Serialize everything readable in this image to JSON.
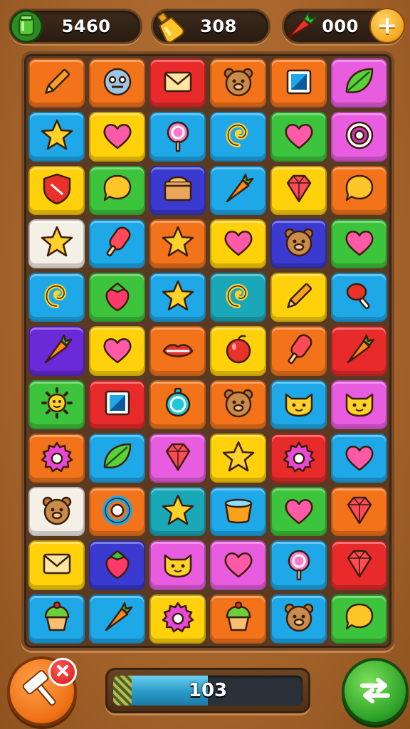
{
  "resources": {
    "coins": {
      "value": "5460",
      "icon": "green-jar-icon"
    },
    "potion": {
      "value": "308",
      "icon": "potion-bottle-icon"
    },
    "gems": {
      "value": "000",
      "icon": "carrot-icon",
      "add_icon": "plus-icon"
    }
  },
  "colors": {
    "orange": "#f2731a",
    "blue": "#1ea8e8",
    "yellow": "#ffd10a",
    "green": "#3cc43c",
    "pink": "#e85ce0",
    "navy": "#3a3ad0",
    "red": "#e82a2a",
    "teal": "#1aa8b8",
    "white": "#f4f0e6",
    "purple": "#6a2ad8",
    "magenta": "#d83ab8",
    "lightorange": "#ff8a2a"
  },
  "board": {
    "rows": [
      [
        {
          "bg": "orange",
          "icon": "pencil-icon"
        },
        {
          "bg": "orange",
          "icon": "robot-face-icon"
        },
        {
          "bg": "red",
          "icon": "envelope-icon"
        },
        {
          "bg": "orange",
          "icon": "bear-face-icon"
        },
        {
          "bg": "orange",
          "icon": "square-badge-icon"
        },
        {
          "bg": "pink",
          "icon": "leaf-icon"
        }
      ],
      [
        {
          "bg": "blue",
          "icon": "star-icon"
        },
        {
          "bg": "yellow",
          "icon": "heart-icon"
        },
        {
          "bg": "blue",
          "icon": "lollipop-icon"
        },
        {
          "bg": "blue",
          "icon": "spiral-icon"
        },
        {
          "bg": "green",
          "icon": "heart-icon"
        },
        {
          "bg": "pink",
          "icon": "donut-icon"
        }
      ],
      [
        {
          "bg": "yellow",
          "icon": "shield-heart-icon"
        },
        {
          "bg": "green",
          "icon": "speech-bubble-icon"
        },
        {
          "bg": "navy",
          "icon": "box-icon"
        },
        {
          "bg": "blue",
          "icon": "carrot-icon"
        },
        {
          "bg": "yellow",
          "icon": "gem-icon"
        },
        {
          "bg": "orange",
          "icon": "speech-bubble-icon"
        }
      ],
      [
        {
          "bg": "white",
          "icon": "star-icon"
        },
        {
          "bg": "blue",
          "icon": "popsicle-icon"
        },
        {
          "bg": "orange",
          "icon": "star-icon"
        },
        {
          "bg": "yellow",
          "icon": "heart-icon"
        },
        {
          "bg": "navy",
          "icon": "bear-face-icon"
        },
        {
          "bg": "green",
          "icon": "heart-icon"
        }
      ],
      [
        {
          "bg": "blue",
          "icon": "spiral-icon"
        },
        {
          "bg": "green",
          "icon": "strawberry-icon"
        },
        {
          "bg": "blue",
          "icon": "star-icon"
        },
        {
          "bg": "teal",
          "icon": "spiral-icon"
        },
        {
          "bg": "yellow",
          "icon": "pencil-icon"
        },
        {
          "bg": "blue",
          "icon": "drumstick-icon"
        }
      ],
      [
        {
          "bg": "purple",
          "icon": "carrot-icon"
        },
        {
          "bg": "yellow",
          "icon": "heart-icon"
        },
        {
          "bg": "orange",
          "icon": "lips-icon"
        },
        {
          "bg": "yellow",
          "icon": "apple-icon"
        },
        {
          "bg": "orange",
          "icon": "popsicle-icon"
        },
        {
          "bg": "red",
          "icon": "carrot-icon"
        }
      ],
      [
        {
          "bg": "green",
          "icon": "sun-icon"
        },
        {
          "bg": "red",
          "icon": "square-badge-icon"
        },
        {
          "bg": "orange",
          "icon": "clock-icon"
        },
        {
          "bg": "orange",
          "icon": "bear-face-icon"
        },
        {
          "bg": "blue",
          "icon": "cat-face-icon"
        },
        {
          "bg": "pink",
          "icon": "cat-face-icon"
        }
      ],
      [
        {
          "bg": "orange",
          "icon": "gear-icon"
        },
        {
          "bg": "blue",
          "icon": "leaf-icon"
        },
        {
          "bg": "pink",
          "icon": "gem-icon"
        },
        {
          "bg": "yellow",
          "icon": "star-icon"
        },
        {
          "bg": "red",
          "icon": "gear-icon"
        },
        {
          "bg": "blue",
          "icon": "heart-icon"
        }
      ],
      [
        {
          "bg": "white",
          "icon": "bear-face-icon"
        },
        {
          "bg": "orange",
          "icon": "ring-icon"
        },
        {
          "bg": "teal",
          "icon": "star-icon"
        },
        {
          "bg": "blue",
          "icon": "cup-icon"
        },
        {
          "bg": "green",
          "icon": "heart-icon"
        },
        {
          "bg": "orange",
          "icon": "gem-icon"
        }
      ],
      [
        {
          "bg": "yellow",
          "icon": "envelope-icon"
        },
        {
          "bg": "navy",
          "icon": "strawberry-icon"
        },
        {
          "bg": "pink",
          "icon": "cat-face-icon"
        },
        {
          "bg": "pink",
          "icon": "heart-icon"
        },
        {
          "bg": "blue",
          "icon": "lollipop-icon"
        },
        {
          "bg": "red",
          "icon": "gem-icon"
        }
      ],
      [
        {
          "bg": "blue",
          "icon": "cupcake-icon"
        },
        {
          "bg": "blue",
          "icon": "carrot-icon"
        },
        {
          "bg": "yellow",
          "icon": "gear-icon"
        },
        {
          "bg": "orange",
          "icon": "cupcake-icon"
        },
        {
          "bg": "blue",
          "icon": "bear-face-icon"
        },
        {
          "bg": "green",
          "icon": "speech-bubble-icon"
        }
      ]
    ]
  },
  "bottom": {
    "hammer_icon": "hammer-icon",
    "cancel_icon": "close-icon",
    "progress": {
      "value": "103",
      "fill_fraction": 0.5
    },
    "shuffle_icon": "shuffle-icon"
  }
}
